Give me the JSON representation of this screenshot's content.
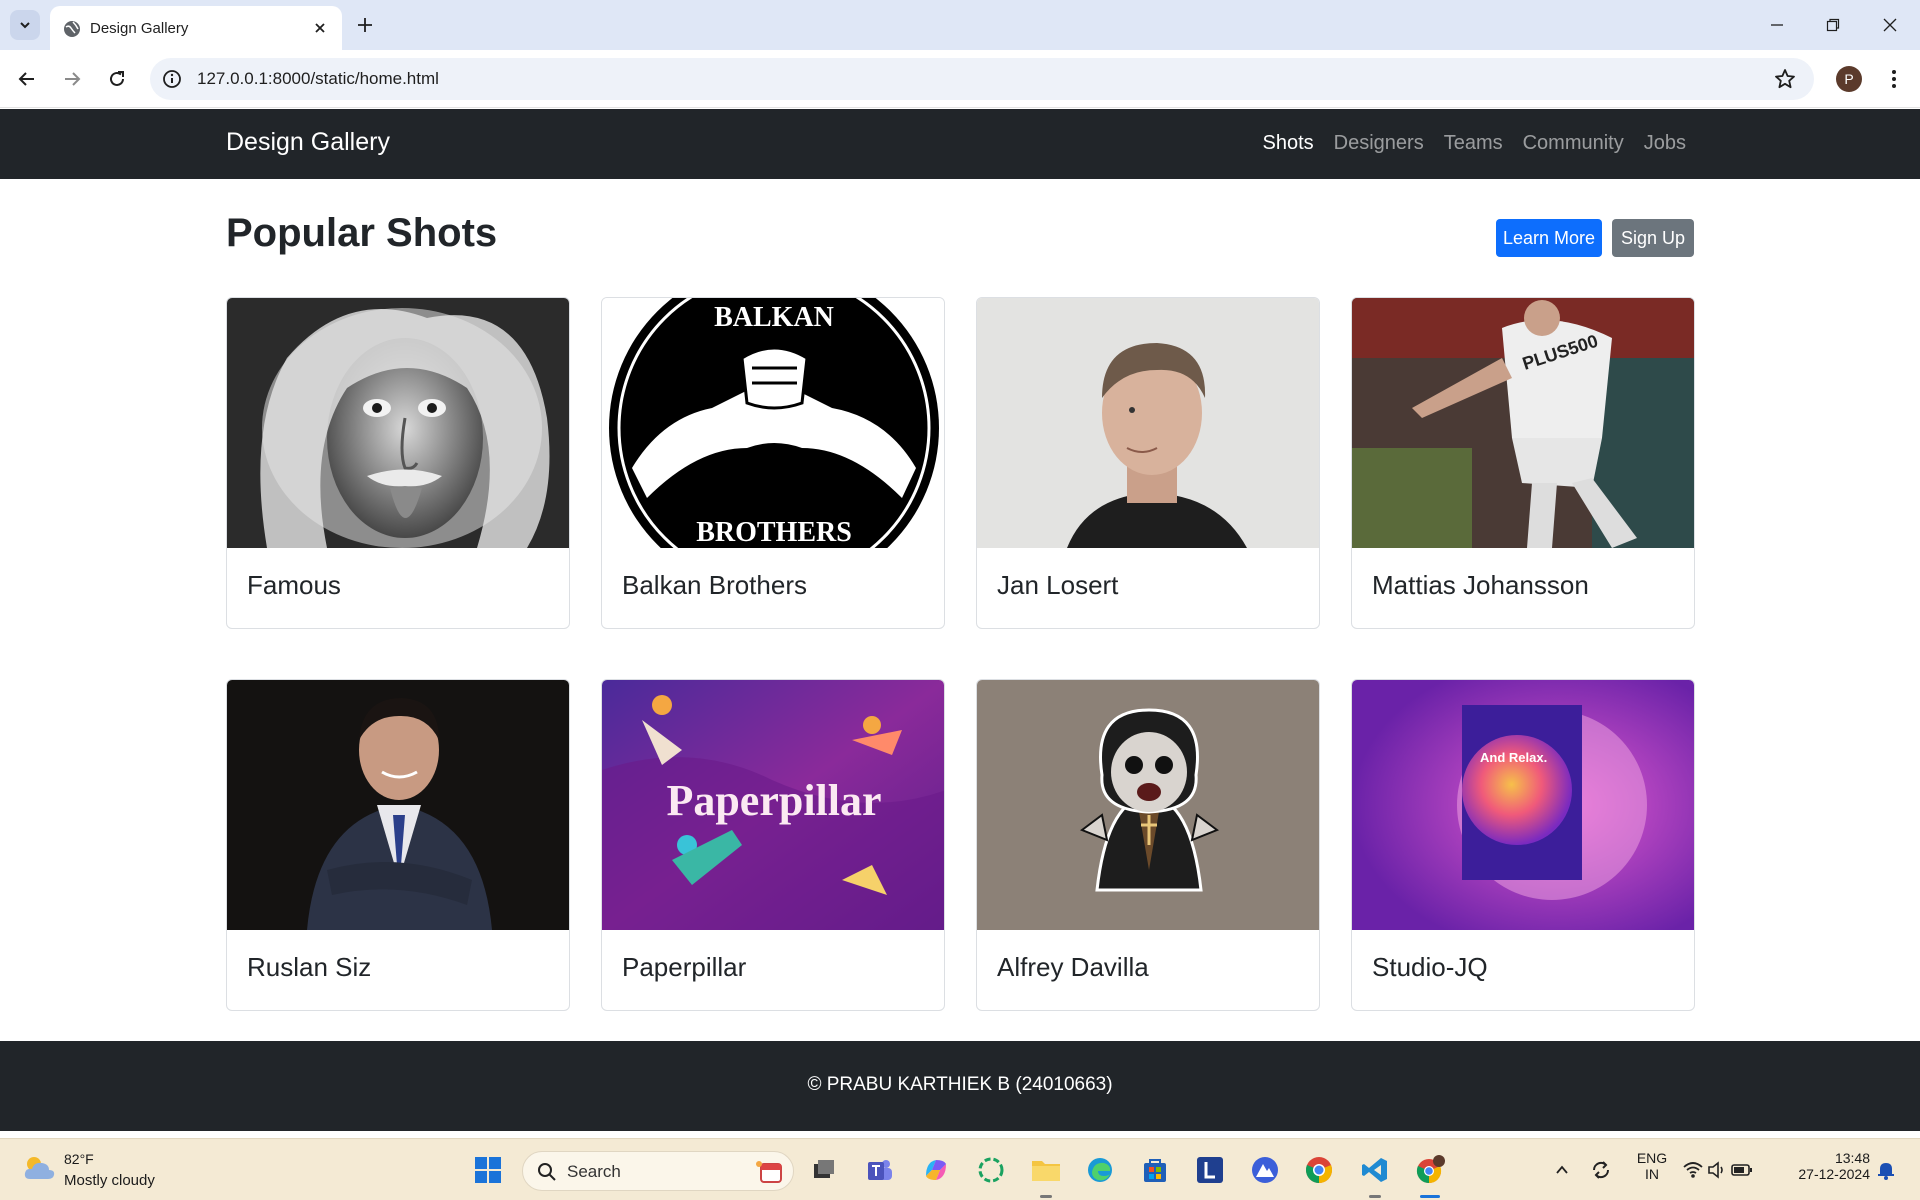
{
  "browser": {
    "tab_title": "Design Gallery",
    "url": "127.0.0.1:8000/static/home.html",
    "profile_initial": "P"
  },
  "site": {
    "brand": "Design Gallery",
    "nav": [
      {
        "label": "Shots",
        "active": true
      },
      {
        "label": "Designers",
        "active": false
      },
      {
        "label": "Teams",
        "active": false
      },
      {
        "label": "Community",
        "active": false
      },
      {
        "label": "Jobs",
        "active": false
      }
    ],
    "page_title": "Popular Shots",
    "buttons": {
      "learn_more": "Learn More",
      "sign_up": "Sign Up"
    },
    "cards": [
      {
        "title": "Famous",
        "image": "einstein-photo"
      },
      {
        "title": "Balkan Brothers",
        "image": "balkan-brothers-logo",
        "logo_top": "BALKAN",
        "logo_bottom": "BROTHERS"
      },
      {
        "title": "Jan Losert",
        "image": "portrait-photo"
      },
      {
        "title": "Mattias Johansson",
        "image": "footballer-photo",
        "jersey_text": "PLUS500"
      },
      {
        "title": "Ruslan Siz",
        "image": "businessman-photo"
      },
      {
        "title": "Paperpillar",
        "image": "paperpillar-illustration",
        "art_text": "Paperpillar"
      },
      {
        "title": "Alfrey Davilla",
        "image": "nun-mascot-illustration"
      },
      {
        "title": "Studio-JQ",
        "image": "poster-mockup",
        "poster_text": "And Relax."
      }
    ],
    "footer": "© PRABU KARTHIEK B (24010663)"
  },
  "taskbar": {
    "weather_temp": "82°F",
    "weather_desc": "Mostly cloudy",
    "search_placeholder": "Search",
    "lang_top": "ENG",
    "lang_bottom": "IN",
    "time": "13:48",
    "date": "27-12-2024"
  },
  "colors": {
    "navbar": "#212529",
    "primary": "#0d6efd",
    "secondary": "#6c757d",
    "taskbar": "#f4ead4"
  }
}
